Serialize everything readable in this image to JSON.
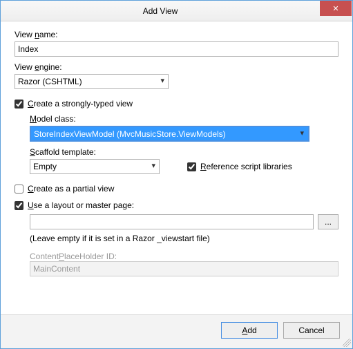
{
  "window": {
    "title": "Add View",
    "close_x": "✕"
  },
  "labels": {
    "view_name": "View name:",
    "view_engine": "View engine:",
    "strongly_typed": "Create a strongly-typed view",
    "model_class": "Model class:",
    "scaffold_template": "Scaffold template:",
    "reference_scripts": "Reference script libraries",
    "partial_view": "Create as a partial view",
    "use_layout": "Use a layout or master page:",
    "layout_hint": "(Leave empty if it is set in a Razor _viewstart file)",
    "cph_id": "ContentPlaceHolder ID:"
  },
  "values": {
    "view_name": "Index",
    "view_engine": "Razor (CSHTML)",
    "model_class": "StoreIndexViewModel (MvcMusicStore.ViewModels)",
    "scaffold_template": "Empty",
    "layout_path": "",
    "cph_id": "MainContent",
    "browse": "..."
  },
  "checks": {
    "strongly_typed": true,
    "reference_scripts": true,
    "partial_view": false,
    "use_layout": true
  },
  "buttons": {
    "add": "Add",
    "cancel": "Cancel"
  }
}
